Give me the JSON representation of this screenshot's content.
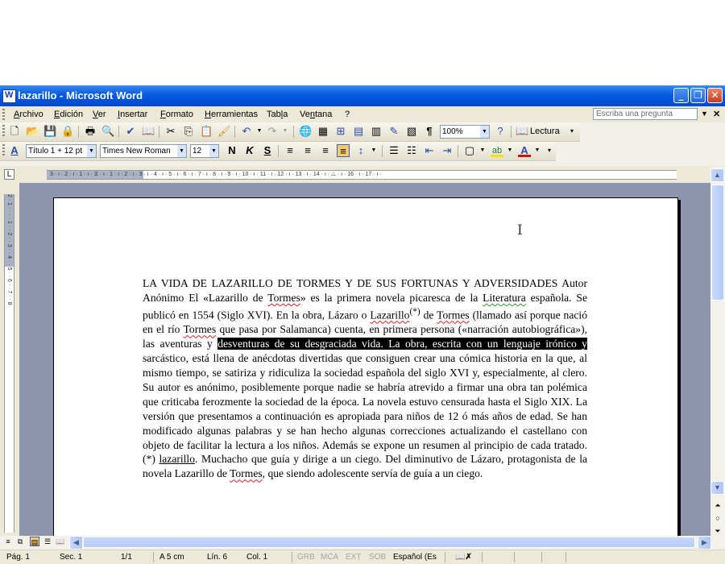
{
  "window": {
    "title": "lazarillo - Microsoft Word",
    "controls": {
      "minimize": "_",
      "maximize": "❐",
      "close": "✕"
    }
  },
  "menubar": {
    "items": [
      {
        "label": "Archivo"
      },
      {
        "label": "Edición"
      },
      {
        "label": "Ver"
      },
      {
        "label": "Insertar"
      },
      {
        "label": "Formato"
      },
      {
        "label": "Herramientas"
      },
      {
        "label": "Tabla"
      },
      {
        "label": "Ventana"
      },
      {
        "label": "?"
      }
    ],
    "ask_placeholder": "Escriba una pregunta"
  },
  "standard_toolbar": {
    "zoom": "100%",
    "read_label": "Lectura"
  },
  "format_toolbar": {
    "style": "Título 1 + 12 pt",
    "font": "Times New Roman",
    "size": "12",
    "bold": "N",
    "italic": "K",
    "underline": "S"
  },
  "ruler": {
    "ticks": "3 · ı · 2 · ı · 1 · ı · ⧖ · ı · 1 · ı · 2 · ı · 3 · ı · 4 · ı · 5 · ı · 6 · ı · 7 · ı · 8 · ı · 9 · ı · 10 · ı · 11 · ı · 12 · ı · 13 · ı · 14 · ı · △ · ı · 16 · ı · 17 · ı ·"
  },
  "vertical_ruler": {
    "ticks": "2 · 1 · · · · 1 · · 2 · · 3 · · 4 · · 5 · · 6 · · 7 · · 8"
  },
  "document": {
    "text_before": "LA VIDA DE LAZARILLO DE TORMES Y DE SUS FORTUNAS Y ADVERSIDADES Autor Anónimo El «Lazarillo de ",
    "w_tormes1": "Tormes",
    "text_2": "» es la primera novela picaresca de la ",
    "w_literatura": "Literatura",
    "text_3": " española. Se publicó en 1554 (Siglo XVI). En la obra, Lázaro o ",
    "w_lazarillo1": "Lazarillo",
    "footnote_mark": "(*)",
    "text_4": " de ",
    "w_tormes2": "Tormes",
    "text_5": " (llamado así porque nació en el río ",
    "w_tormes3": "Tormes",
    "text_6": " que pasa por Salamanca) cuenta, en primera persona («narración autobiográfica»), las aventuras y ",
    "selected": "desventuras de su desgraciada vida. La obra, escrita con un lenguaje irónico y",
    "text_7": " sarcástico, está llena de anécdotas divertidas que consiguen crear una cómica historia en la que, al mismo tiempo, se satiriza y ridiculiza la sociedad española del siglo XVI y, especialmente, al clero. Su autor es anónimo, posiblemente porque nadie se habría atrevido a firmar una obra tan polémica que criticaba ferozmente la sociedad de la época. La novela estuvo censurada hasta el Siglo XIX. La versión que presentamos a continuación es apropiada para niños de 12 ó más años de edad. Se han modificado algunas palabras y se han hecho algunas correcciones actualizando el castellano con objeto de facilitar la lectura a los niños. Además se expone un resumen al principio de cada tratado. (*) ",
    "w_lazarillo2": "lazarillo",
    "text_8": ". Muchacho que guía y dirige a un ciego. Del diminutivo de Lázaro, protagonista de la novela Lazarillo de ",
    "w_tormes4": "Tormes",
    "text_9": ", que siendo adolescente servía de guía a un ciego."
  },
  "statusbar": {
    "page": "Pág. 1",
    "section": "Sec. 1",
    "pages": "1/1",
    "at": "A 5 cm",
    "line": "Lín. 6",
    "col": "Col. 1",
    "grb": "GRB",
    "mca": "MCA",
    "ext": "EXT",
    "sob": "SOB",
    "language": "Español (Es"
  }
}
